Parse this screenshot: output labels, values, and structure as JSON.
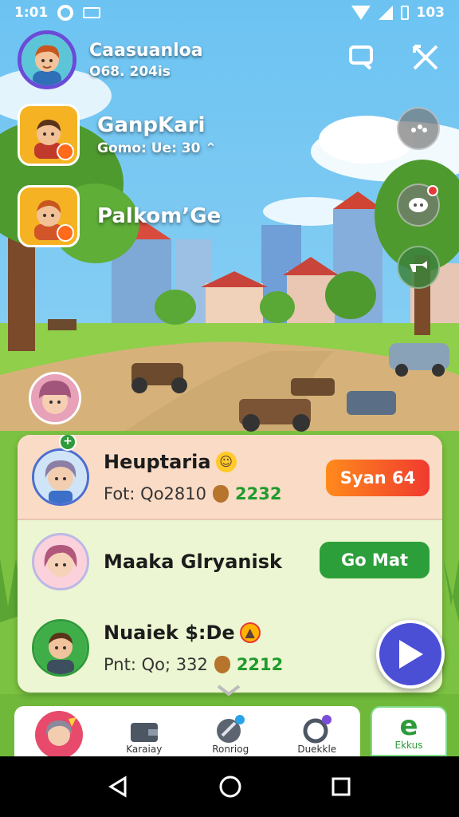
{
  "status_bar": {
    "time": "1:01",
    "battery_text": "103",
    "icons": [
      "circle-icon",
      "mail-icon",
      "wifi-icon",
      "signal-icon",
      "battery-icon"
    ]
  },
  "player": {
    "name": "Caasuanloa",
    "sub": "O68. 204is"
  },
  "top_actions": {
    "icons": [
      "chat-icon",
      "swords-icon"
    ]
  },
  "friends": [
    {
      "name": "GanpKari",
      "sub": "Gomo: Ue: 30 ⌃"
    },
    {
      "name": "Palkom’Ge",
      "sub": ""
    }
  ],
  "side_buttons": [
    "speech-icon",
    "notification-icon",
    "horn-icon"
  ],
  "leaderboard": {
    "rows": [
      {
        "name": "Heuptaria",
        "stat_label": "Fot: Qo2810",
        "stat_value": "2232",
        "button": "Syan 64",
        "highlight": true
      },
      {
        "name": "Maaka Glryanisk",
        "stat_label": "",
        "stat_value": "",
        "button": "Go Mat"
      },
      {
        "name": "Nuaiek $:De",
        "stat_label": "Pnt: Qo; 332",
        "stat_value": "2212",
        "button": ""
      }
    ]
  },
  "bottom_nav": {
    "items": [
      {
        "label": ""
      },
      {
        "label": "Karaiay"
      },
      {
        "label": "Ronriog"
      },
      {
        "label": "Duekkle"
      }
    ],
    "shop_label": "Ekkus",
    "shop_glyph": "e"
  },
  "colors": {
    "accent_purple": "#6a4cd8",
    "orange_button": "#f03a2f",
    "green_button": "#2d9f3a",
    "play_button": "#4a4fd6"
  }
}
